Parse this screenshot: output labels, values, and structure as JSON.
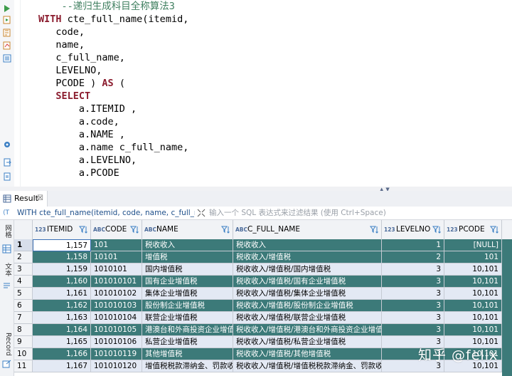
{
  "editor": {
    "lines": [
      {
        "indent": "    ",
        "parts": [
          {
            "t": "--递归生成科目全称算法3",
            "c": "cm"
          }
        ]
      },
      {
        "indent": "",
        "parts": [
          {
            "t": "WITH",
            "c": "kw"
          },
          {
            "t": " cte_full_name(itemid,",
            "c": ""
          }
        ]
      },
      {
        "indent": "   ",
        "parts": [
          {
            "t": "code,",
            "c": ""
          }
        ]
      },
      {
        "indent": "   ",
        "parts": [
          {
            "t": "name,",
            "c": ""
          }
        ]
      },
      {
        "indent": "   ",
        "parts": [
          {
            "t": "c_full_name,",
            "c": ""
          }
        ]
      },
      {
        "indent": "   ",
        "parts": [
          {
            "t": "LEVELNO,",
            "c": ""
          }
        ]
      },
      {
        "indent": "   ",
        "parts": [
          {
            "t": "PCODE ) ",
            "c": ""
          },
          {
            "t": "AS",
            "c": "kw"
          },
          {
            "t": " (",
            "c": ""
          }
        ]
      },
      {
        "indent": "   ",
        "parts": [
          {
            "t": "SELECT",
            "c": "kw"
          }
        ]
      },
      {
        "indent": "       ",
        "parts": [
          {
            "t": "a.ITEMID ,",
            "c": ""
          }
        ]
      },
      {
        "indent": "       ",
        "parts": [
          {
            "t": "a.code,",
            "c": ""
          }
        ]
      },
      {
        "indent": "       ",
        "parts": [
          {
            "t": "a.NAME ,",
            "c": ""
          }
        ]
      },
      {
        "indent": "       ",
        "parts": [
          {
            "t": "a.name c_full_name,",
            "c": ""
          }
        ]
      },
      {
        "indent": "       ",
        "parts": [
          {
            "t": "a.LEVELNO,",
            "c": ""
          }
        ]
      },
      {
        "indent": "       ",
        "parts": [
          {
            "t": "a.PCODE",
            "c": ""
          }
        ]
      }
    ]
  },
  "result_tab": {
    "label": "Result",
    "close": "☒"
  },
  "querybar": {
    "query_text": "WITH cte_full_name(itemid, code, name, c_full_name,",
    "filter_placeholder": "输入一个 SQL 表达式来过滤结果 (使用 Ctrl+Space)"
  },
  "side_tabs": {
    "grid": "网格",
    "text": "文本",
    "record": "Record"
  },
  "table": {
    "columns": [
      {
        "type": "123",
        "name": "ITEMID"
      },
      {
        "type": "ABC",
        "name": "CODE"
      },
      {
        "type": "ABC",
        "name": "NAME"
      },
      {
        "type": "ABC",
        "name": "C_FULL_NAME"
      },
      {
        "type": "123",
        "name": "LEVELNO"
      },
      {
        "type": "123",
        "name": "PCODE"
      }
    ],
    "rows": [
      {
        "n": "1",
        "itemid": "1,157",
        "code": "101",
        "name": "税收收入",
        "full": "税收收入",
        "level": "1",
        "pcode": "[NULL]"
      },
      {
        "n": "2",
        "itemid": "1,158",
        "code": "10101",
        "name": "增值税",
        "full": "税收收入/增值税",
        "level": "2",
        "pcode": "101"
      },
      {
        "n": "3",
        "itemid": "1,159",
        "code": "1010101",
        "name": "国内增值税",
        "full": "税收收入/增值税/国内增值税",
        "level": "3",
        "pcode": "10,101"
      },
      {
        "n": "4",
        "itemid": "1,160",
        "code": "101010101",
        "name": "国有企业增值税",
        "full": "税收收入/增值税/国有企业增值税",
        "level": "3",
        "pcode": "10,101"
      },
      {
        "n": "5",
        "itemid": "1,161",
        "code": "101010102",
        "name": "集体企业增值税",
        "full": "税收收入/增值税/集体企业增值税",
        "level": "3",
        "pcode": "10,101"
      },
      {
        "n": "6",
        "itemid": "1,162",
        "code": "101010103",
        "name": "股份制企业增值税",
        "full": "税收收入/增值税/股份制企业增值税",
        "level": "3",
        "pcode": "10,101"
      },
      {
        "n": "7",
        "itemid": "1,163",
        "code": "101010104",
        "name": "联营企业增值税",
        "full": "税收收入/增值税/联营企业增值税",
        "level": "3",
        "pcode": "10,101"
      },
      {
        "n": "8",
        "itemid": "1,164",
        "code": "101010105",
        "name": "港澳台和外商投资企业增值税",
        "full": "税收收入/增值税/港澳台和外商投资企业增值税",
        "level": "3",
        "pcode": "10,101"
      },
      {
        "n": "9",
        "itemid": "1,165",
        "code": "101010106",
        "name": "私营企业增值税",
        "full": "税收收入/增值税/私营企业增值税",
        "level": "3",
        "pcode": "10,101"
      },
      {
        "n": "10",
        "itemid": "1,166",
        "code": "101010119",
        "name": "其他增值税",
        "full": "税收收入/增值税/其他增值税",
        "level": "3",
        "pcode": "10,101"
      },
      {
        "n": "11",
        "itemid": "1,167",
        "code": "101010120",
        "name": "增值税税款滞纳金、罚款收入",
        "full": "税收收入/增值税/增值税税款滞纳金、罚款收入",
        "level": "3",
        "pcode": "10,101"
      }
    ]
  },
  "watermark": "知乎 @felix",
  "colors": {
    "row_dark": "#3c7a79",
    "row_light": "#e3e9f4",
    "keyword": "#8b1c2e",
    "comment": "#3f7f5f"
  }
}
